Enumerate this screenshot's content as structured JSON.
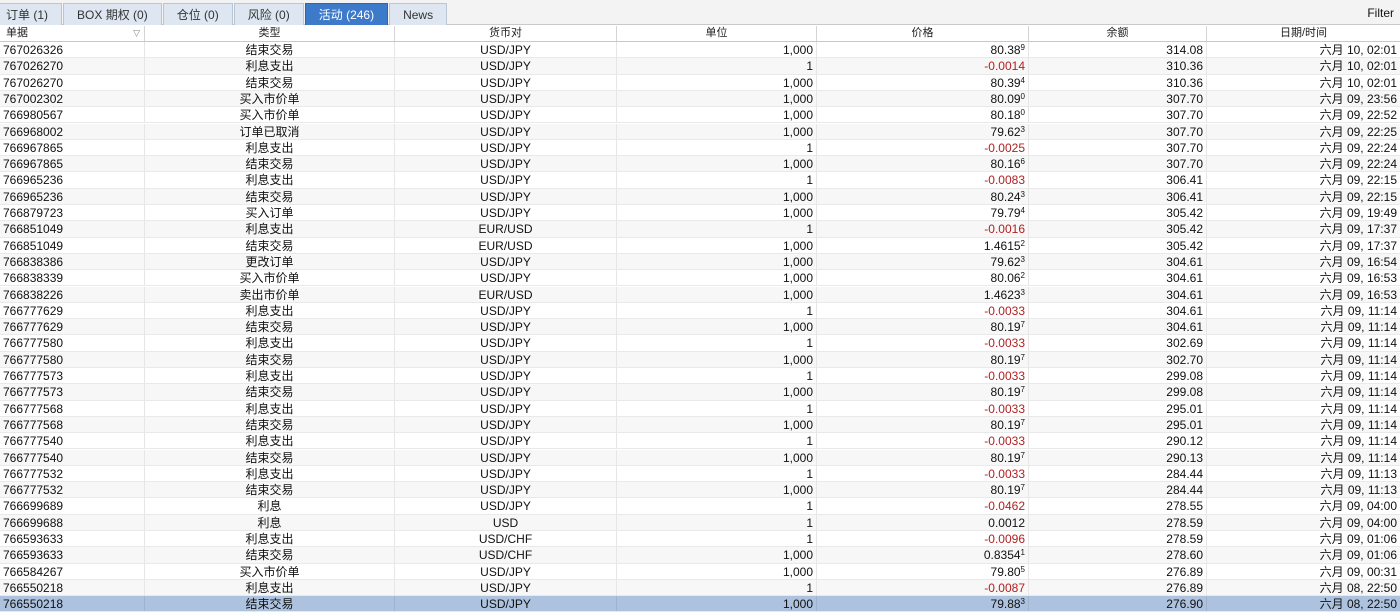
{
  "tabs": [
    {
      "label": "订单 (1)",
      "active": false
    },
    {
      "label": "BOX 期权 (0)",
      "active": false
    },
    {
      "label": "仓位 (0)",
      "active": false
    },
    {
      "label": "风险 (0)",
      "active": false
    },
    {
      "label": "活动 (246)",
      "active": true
    },
    {
      "label": "News",
      "active": false
    }
  ],
  "filter_label": "Filter",
  "columns": [
    "单据",
    "类型",
    "货币对",
    "单位",
    "价格",
    "余额",
    "日期/时间"
  ],
  "sort_icon": "sort-funnel-icon",
  "colors": {
    "negative": "#b32020",
    "active_tab": "#3d7ac9",
    "selected_row": "#adc2de"
  },
  "rows": [
    {
      "ticket": "767026326",
      "type": "结束交易",
      "pair": "USD/JPY",
      "units": "1,000",
      "price": "80.38",
      "price_sup": "9",
      "negative": false,
      "balance": "314.08",
      "datetime": "六月 10, 02:01"
    },
    {
      "ticket": "767026270",
      "type": "利息支出",
      "pair": "USD/JPY",
      "units": "1",
      "price": "-0.0014",
      "price_sup": "",
      "negative": true,
      "balance": "310.36",
      "datetime": "六月 10, 02:01"
    },
    {
      "ticket": "767026270",
      "type": "结束交易",
      "pair": "USD/JPY",
      "units": "1,000",
      "price": "80.39",
      "price_sup": "4",
      "negative": false,
      "balance": "310.36",
      "datetime": "六月 10, 02:01"
    },
    {
      "ticket": "767002302",
      "type": "买入市价单",
      "pair": "USD/JPY",
      "units": "1,000",
      "price": "80.09",
      "price_sup": "0",
      "negative": false,
      "balance": "307.70",
      "datetime": "六月 09, 23:56"
    },
    {
      "ticket": "766980567",
      "type": "买入市价单",
      "pair": "USD/JPY",
      "units": "1,000",
      "price": "80.18",
      "price_sup": "0",
      "negative": false,
      "balance": "307.70",
      "datetime": "六月 09, 22:52"
    },
    {
      "ticket": "766968002",
      "type": "订单已取消",
      "pair": "USD/JPY",
      "units": "1,000",
      "price": "79.62",
      "price_sup": "3",
      "negative": false,
      "balance": "307.70",
      "datetime": "六月 09, 22:25"
    },
    {
      "ticket": "766967865",
      "type": "利息支出",
      "pair": "USD/JPY",
      "units": "1",
      "price": "-0.0025",
      "price_sup": "",
      "negative": true,
      "balance": "307.70",
      "datetime": "六月 09, 22:24"
    },
    {
      "ticket": "766967865",
      "type": "结束交易",
      "pair": "USD/JPY",
      "units": "1,000",
      "price": "80.16",
      "price_sup": "6",
      "negative": false,
      "balance": "307.70",
      "datetime": "六月 09, 22:24"
    },
    {
      "ticket": "766965236",
      "type": "利息支出",
      "pair": "USD/JPY",
      "units": "1",
      "price": "-0.0083",
      "price_sup": "",
      "negative": true,
      "balance": "306.41",
      "datetime": "六月 09, 22:15"
    },
    {
      "ticket": "766965236",
      "type": "结束交易",
      "pair": "USD/JPY",
      "units": "1,000",
      "price": "80.24",
      "price_sup": "3",
      "negative": false,
      "balance": "306.41",
      "datetime": "六月 09, 22:15"
    },
    {
      "ticket": "766879723",
      "type": "买入订单",
      "pair": "USD/JPY",
      "units": "1,000",
      "price": "79.79",
      "price_sup": "4",
      "negative": false,
      "balance": "305.42",
      "datetime": "六月 09, 19:49"
    },
    {
      "ticket": "766851049",
      "type": "利息支出",
      "pair": "EUR/USD",
      "units": "1",
      "price": "-0.0016",
      "price_sup": "",
      "negative": true,
      "balance": "305.42",
      "datetime": "六月 09, 17:37"
    },
    {
      "ticket": "766851049",
      "type": "结束交易",
      "pair": "EUR/USD",
      "units": "1,000",
      "price": "1.4615",
      "price_sup": "2",
      "negative": false,
      "balance": "305.42",
      "datetime": "六月 09, 17:37"
    },
    {
      "ticket": "766838386",
      "type": "更改订单",
      "pair": "USD/JPY",
      "units": "1,000",
      "price": "79.62",
      "price_sup": "3",
      "negative": false,
      "balance": "304.61",
      "datetime": "六月 09, 16:54"
    },
    {
      "ticket": "766838339",
      "type": "买入市价单",
      "pair": "USD/JPY",
      "units": "1,000",
      "price": "80.06",
      "price_sup": "2",
      "negative": false,
      "balance": "304.61",
      "datetime": "六月 09, 16:53"
    },
    {
      "ticket": "766838226",
      "type": "卖出市价单",
      "pair": "EUR/USD",
      "units": "1,000",
      "price": "1.4623",
      "price_sup": "3",
      "negative": false,
      "balance": "304.61",
      "datetime": "六月 09, 16:53"
    },
    {
      "ticket": "766777629",
      "type": "利息支出",
      "pair": "USD/JPY",
      "units": "1",
      "price": "-0.0033",
      "price_sup": "",
      "negative": true,
      "balance": "304.61",
      "datetime": "六月 09, 11:14"
    },
    {
      "ticket": "766777629",
      "type": "结束交易",
      "pair": "USD/JPY",
      "units": "1,000",
      "price": "80.19",
      "price_sup": "7",
      "negative": false,
      "balance": "304.61",
      "datetime": "六月 09, 11:14"
    },
    {
      "ticket": "766777580",
      "type": "利息支出",
      "pair": "USD/JPY",
      "units": "1",
      "price": "-0.0033",
      "price_sup": "",
      "negative": true,
      "balance": "302.69",
      "datetime": "六月 09, 11:14"
    },
    {
      "ticket": "766777580",
      "type": "结束交易",
      "pair": "USD/JPY",
      "units": "1,000",
      "price": "80.19",
      "price_sup": "7",
      "negative": false,
      "balance": "302.70",
      "datetime": "六月 09, 11:14"
    },
    {
      "ticket": "766777573",
      "type": "利息支出",
      "pair": "USD/JPY",
      "units": "1",
      "price": "-0.0033",
      "price_sup": "",
      "negative": true,
      "balance": "299.08",
      "datetime": "六月 09, 11:14"
    },
    {
      "ticket": "766777573",
      "type": "结束交易",
      "pair": "USD/JPY",
      "units": "1,000",
      "price": "80.19",
      "price_sup": "7",
      "negative": false,
      "balance": "299.08",
      "datetime": "六月 09, 11:14"
    },
    {
      "ticket": "766777568",
      "type": "利息支出",
      "pair": "USD/JPY",
      "units": "1",
      "price": "-0.0033",
      "price_sup": "",
      "negative": true,
      "balance": "295.01",
      "datetime": "六月 09, 11:14"
    },
    {
      "ticket": "766777568",
      "type": "结束交易",
      "pair": "USD/JPY",
      "units": "1,000",
      "price": "80.19",
      "price_sup": "7",
      "negative": false,
      "balance": "295.01",
      "datetime": "六月 09, 11:14"
    },
    {
      "ticket": "766777540",
      "type": "利息支出",
      "pair": "USD/JPY",
      "units": "1",
      "price": "-0.0033",
      "price_sup": "",
      "negative": true,
      "balance": "290.12",
      "datetime": "六月 09, 11:14"
    },
    {
      "ticket": "766777540",
      "type": "结束交易",
      "pair": "USD/JPY",
      "units": "1,000",
      "price": "80.19",
      "price_sup": "7",
      "negative": false,
      "balance": "290.13",
      "datetime": "六月 09, 11:14"
    },
    {
      "ticket": "766777532",
      "type": "利息支出",
      "pair": "USD/JPY",
      "units": "1",
      "price": "-0.0033",
      "price_sup": "",
      "negative": true,
      "balance": "284.44",
      "datetime": "六月 09, 11:13"
    },
    {
      "ticket": "766777532",
      "type": "结束交易",
      "pair": "USD/JPY",
      "units": "1,000",
      "price": "80.19",
      "price_sup": "7",
      "negative": false,
      "balance": "284.44",
      "datetime": "六月 09, 11:13"
    },
    {
      "ticket": "766699689",
      "type": "利息",
      "pair": "USD/JPY",
      "units": "1",
      "price": "-0.0462",
      "price_sup": "",
      "negative": true,
      "balance": "278.55",
      "datetime": "六月 09, 04:00"
    },
    {
      "ticket": "766699688",
      "type": "利息",
      "pair": "USD",
      "units": "1",
      "price": "0.0012",
      "price_sup": "",
      "negative": false,
      "balance": "278.59",
      "datetime": "六月 09, 04:00"
    },
    {
      "ticket": "766593633",
      "type": "利息支出",
      "pair": "USD/CHF",
      "units": "1",
      "price": "-0.0096",
      "price_sup": "",
      "negative": true,
      "balance": "278.59",
      "datetime": "六月 09, 01:06"
    },
    {
      "ticket": "766593633",
      "type": "结束交易",
      "pair": "USD/CHF",
      "units": "1,000",
      "price": "0.8354",
      "price_sup": "1",
      "negative": false,
      "balance": "278.60",
      "datetime": "六月 09, 01:06"
    },
    {
      "ticket": "766584267",
      "type": "买入市价单",
      "pair": "USD/JPY",
      "units": "1,000",
      "price": "79.80",
      "price_sup": "5",
      "negative": false,
      "balance": "276.89",
      "datetime": "六月 09, 00:31"
    },
    {
      "ticket": "766550218",
      "type": "利息支出",
      "pair": "USD/JPY",
      "units": "1",
      "price": "-0.0087",
      "price_sup": "",
      "negative": true,
      "balance": "276.89",
      "datetime": "六月 08, 22:50"
    },
    {
      "ticket": "766550218",
      "type": "结束交易",
      "pair": "USD/JPY",
      "units": "1,000",
      "price": "79.88",
      "price_sup": "3",
      "negative": false,
      "balance": "276.90",
      "datetime": "六月 08, 22:50",
      "selected": true
    }
  ]
}
